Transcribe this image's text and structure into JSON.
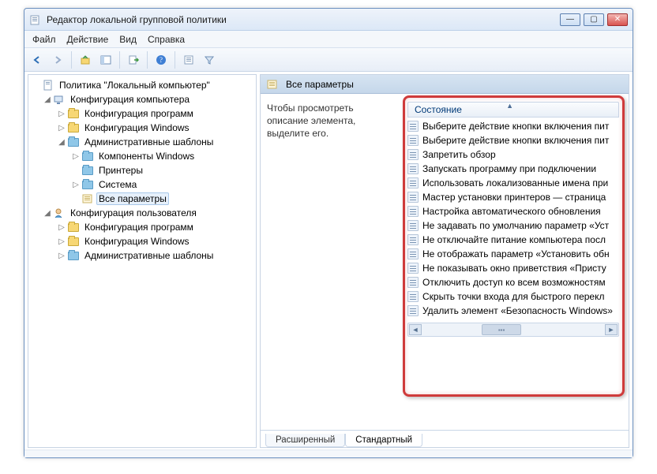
{
  "window": {
    "title": "Редактор локальной групповой политики"
  },
  "menu": {
    "file": "Файл",
    "action": "Действие",
    "view": "Вид",
    "help": "Справка"
  },
  "tree": {
    "root": "Политика \"Локальный компьютер\"",
    "comp_cfg": "Конфигурация компьютера",
    "prog_cfg": "Конфигурация программ",
    "win_cfg": "Конфигурация Windows",
    "adm_tmpl": "Административные шаблоны",
    "comp_win": "Компоненты Windows",
    "printers": "Принтеры",
    "system": "Система",
    "all_params": "Все параметры",
    "user_cfg": "Конфигурация пользователя",
    "u_prog_cfg": "Конфигурация программ",
    "u_win_cfg": "Конфигурация Windows",
    "u_adm_tmpl": "Административные шаблоны"
  },
  "right": {
    "header": "Все параметры",
    "desc": "Чтобы просмотреть описание элемента, выделите его.",
    "column": "Состояние",
    "items": [
      "Выберите действие кнопки включения пит",
      "Выберите действие кнопки включения пит",
      "Запретить обзор",
      "Запускать программу при подключении",
      "Использовать локализованные имена при",
      "Мастер установки принтеров — страница",
      "Настройка автоматического обновления",
      "Не задавать по умолчанию параметр «Уст",
      "Не отключайте питание компьютера посл",
      "Не отображать параметр «Установить обн",
      "Не показывать окно приветствия «Присту",
      "Отключить доступ ко всем возможностям",
      "Скрыть точки входа для быстрого перекл",
      "Удалить элемент «Безопасность Windows»"
    ]
  },
  "tabs": {
    "extended": "Расширенный",
    "standard": "Стандартный"
  }
}
